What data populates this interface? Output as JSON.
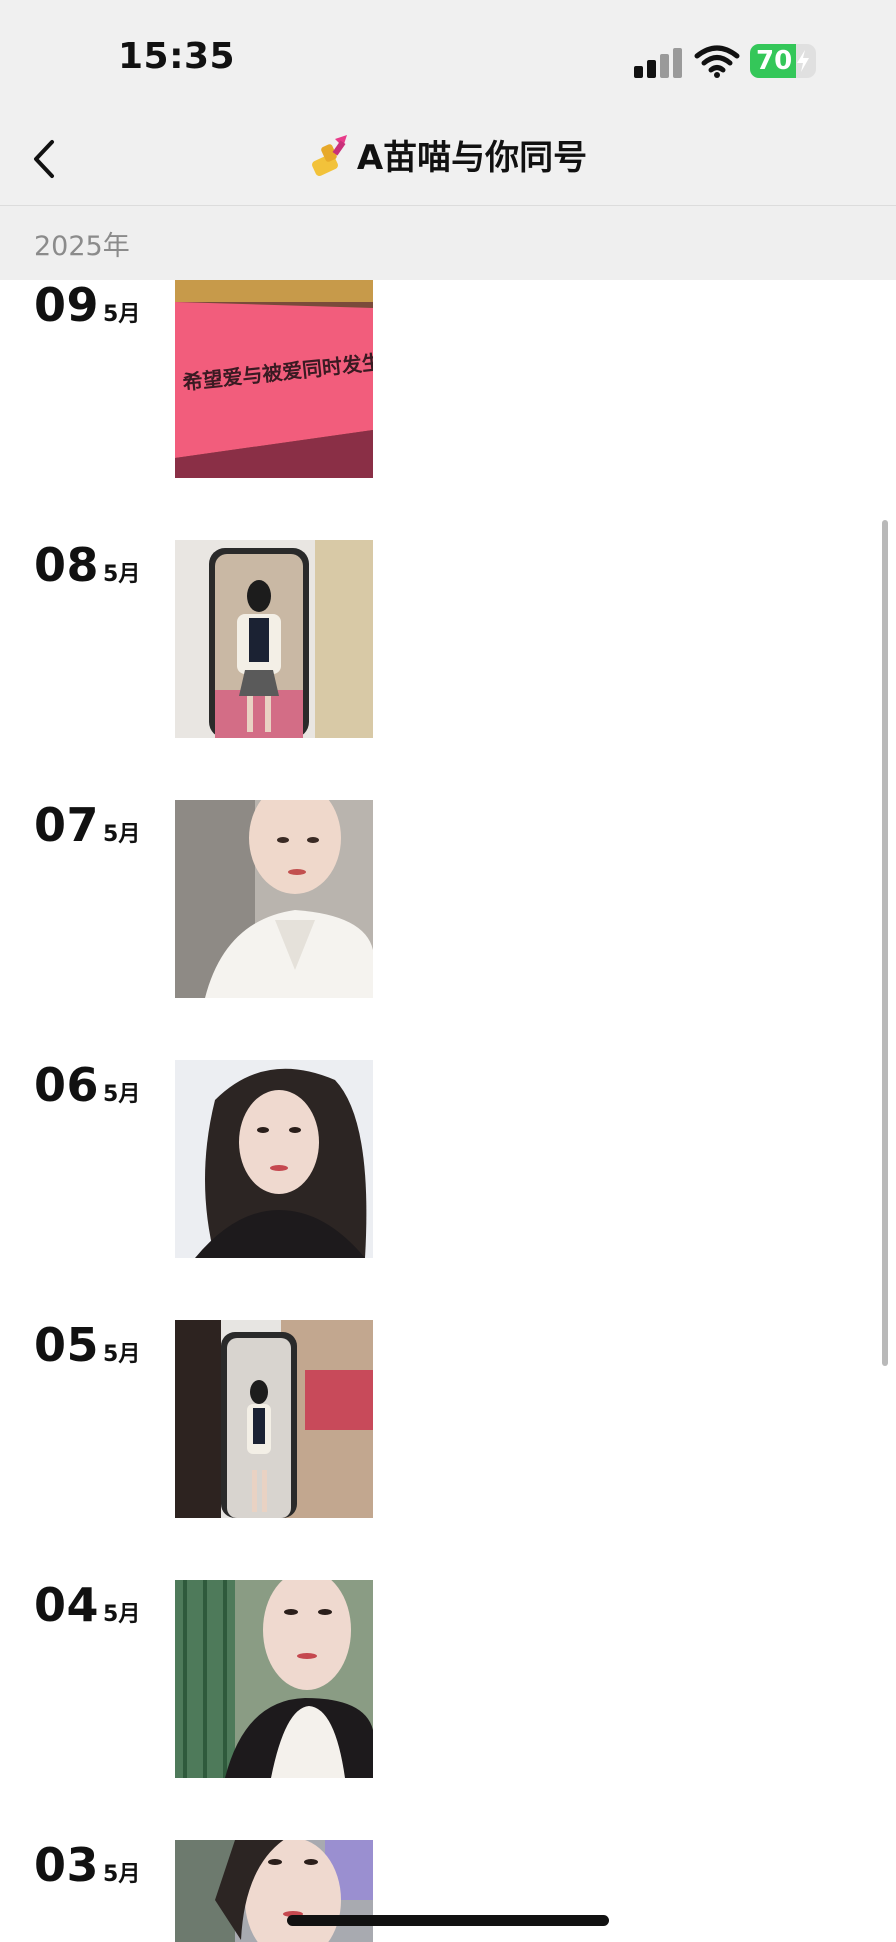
{
  "status_bar": {
    "time": "15:35",
    "battery_level": "70",
    "battery_fraction": 0.7
  },
  "nav": {
    "title": "A苗喵与你同号",
    "title_icon": "nail-polish-emoji-icon",
    "back_icon": "chevron-left-icon"
  },
  "section": {
    "year": "2025年"
  },
  "entries": [
    {
      "day": "09",
      "month": "5月",
      "photo": "pink-banner-photo",
      "banner_text": "希望爱与被爱同时发生"
    },
    {
      "day": "08",
      "month": "5月",
      "photo": "mirror-selfie-photo"
    },
    {
      "day": "07",
      "month": "5月",
      "photo": "selfie-white-blouse-photo"
    },
    {
      "day": "06",
      "month": "5月",
      "photo": "selfie-portrait-photo"
    },
    {
      "day": "05",
      "month": "5月",
      "photo": "mirror-full-body-photo"
    },
    {
      "day": "04",
      "month": "5月",
      "photo": "selfie-lace-top-photo"
    },
    {
      "day": "03",
      "month": "5月",
      "photo": "selfie-outdoor-photo"
    }
  ]
}
